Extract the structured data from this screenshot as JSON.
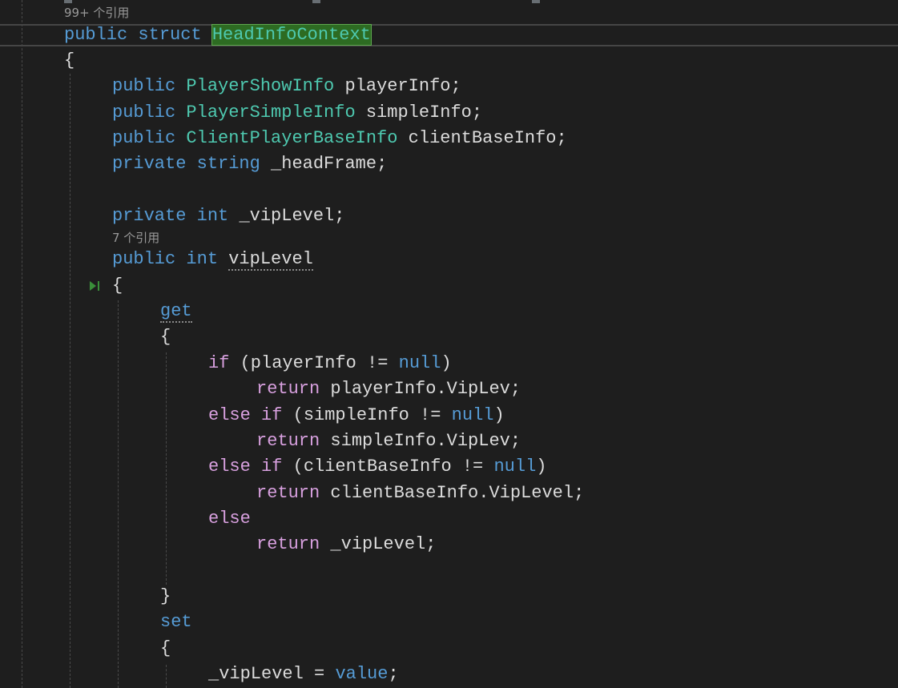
{
  "code_lens": {
    "struct_refs": "99+ 个引用",
    "viplevel_refs": "7 个引用"
  },
  "lines": {
    "struct_kw1": "public",
    "struct_kw2": "struct",
    "struct_name": "HeadInfoContext",
    "brace_open_1": "{",
    "f1_kw": "public",
    "f1_type": "PlayerShowInfo",
    "f1_name": "playerInfo;",
    "f2_kw": "public",
    "f2_type": "PlayerSimpleInfo",
    "f2_name": "simpleInfo;",
    "f3_kw": "public",
    "f3_type": "ClientPlayerBaseInfo",
    "f3_name": "clientBaseInfo;",
    "f4_kw1": "private",
    "f4_kw2": "string",
    "f4_name": "_headFrame;",
    "f5_kw1": "private",
    "f5_kw2": "int",
    "f5_name": "_vipLevel;",
    "p_kw1": "public",
    "p_kw2": "int",
    "p_name": "vipLevel",
    "brace_open_2": "{",
    "get_kw": "get",
    "brace_open_3": "{",
    "if1_kw": "if",
    "if1_cond": "(playerInfo != ",
    "if1_null": "null",
    "if1_close": ")",
    "ret1_kw": "return",
    "ret1_val": "playerInfo.VipLev;",
    "if2_else": "else",
    "if2_if": "if",
    "if2_cond": "(simpleInfo != ",
    "if2_null": "null",
    "if2_close": ")",
    "ret2_kw": "return",
    "ret2_val": "simpleInfo.VipLev;",
    "if3_else": "else",
    "if3_if": "if",
    "if3_cond": "(clientBaseInfo != ",
    "if3_null": "null",
    "if3_close": ")",
    "ret3_kw": "return",
    "ret3_val": "clientBaseInfo.VipLevel;",
    "else_kw": "else",
    "ret4_kw": "return",
    "ret4_val": "_vipLevel;",
    "brace_close_3": "}",
    "set_kw": "set",
    "brace_open_4": "{",
    "assign_lhs": "_vipLevel = ",
    "assign_val": "value",
    "assign_end": ";"
  },
  "colors": {
    "background": "#1e1e1e",
    "keyword": "#569cd6",
    "control_keyword": "#d8a0df",
    "type": "#4ec9b0",
    "identifier": "#dcdcdc",
    "highlight": "#2d6b22"
  }
}
